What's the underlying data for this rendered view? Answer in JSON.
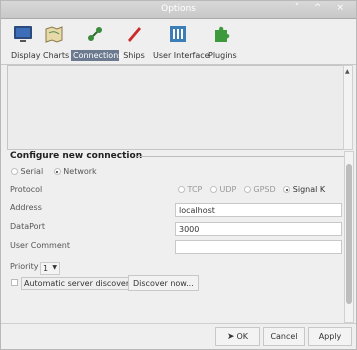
{
  "window": {
    "title": "Options",
    "controls": "˅ ^ ×"
  },
  "toolbar": {
    "items": [
      {
        "label": "Display"
      },
      {
        "label": "Charts"
      },
      {
        "label": "Connections"
      },
      {
        "label": "Ships"
      },
      {
        "label": "User Interface"
      },
      {
        "label": "Plugins"
      }
    ]
  },
  "connection": {
    "section_title": "Configure new connection",
    "type_serial": "Serial",
    "type_network": "Network",
    "protocol_label": "Protocol",
    "protocols": [
      "TCP",
      "UDP",
      "GPSD",
      "Signal K"
    ],
    "address_label": "Address",
    "address_value": "localhost",
    "dataport_label": "DataPort",
    "dataport_value": "3000",
    "comment_label": "User Comment",
    "comment_value": "",
    "priority_label": "Priority",
    "priority_value": "1",
    "auto_discovery_label": "Automatic server discovery",
    "discover_button": "Discover now..."
  },
  "buttons": {
    "ok": "OK",
    "cancel": "Cancel",
    "apply": "Apply"
  }
}
